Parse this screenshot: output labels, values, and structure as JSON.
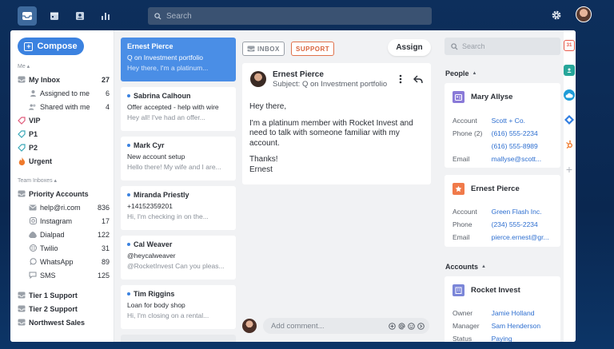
{
  "topbar": {
    "search_placeholder": "Search"
  },
  "sidebar": {
    "compose_label": "Compose",
    "me_label": "Me",
    "me_items": [
      {
        "label": "My Inbox",
        "count": "27"
      },
      {
        "label": "Assigned to me",
        "count": "6"
      },
      {
        "label": "Shared with me",
        "count": "4"
      }
    ],
    "tags": [
      {
        "label": "VIP",
        "color": "#e05a7a"
      },
      {
        "label": "P1",
        "color": "#3aa8b8"
      },
      {
        "label": "P2",
        "color": "#3aa8b8"
      },
      {
        "label": "Urgent",
        "color": "#ef7a2c"
      }
    ],
    "team_label": "Team Inboxes",
    "priority_label": "Priority Accounts",
    "team_items": [
      {
        "label": "help@ri.com",
        "count": "836"
      },
      {
        "label": "Instagram",
        "count": "17"
      },
      {
        "label": "Dialpad",
        "count": "122"
      },
      {
        "label": "Twilio",
        "count": "31"
      },
      {
        "label": "WhatsApp",
        "count": "89"
      },
      {
        "label": "SMS",
        "count": "125"
      }
    ],
    "bottom_items": [
      {
        "label": "Tier 1 Support"
      },
      {
        "label": "Tier 2 Support"
      },
      {
        "label": "Northwest Sales"
      }
    ]
  },
  "conversations": [
    {
      "name": "Ernest Pierce",
      "subject": "Q on Investment portfolio",
      "preview": "Hey there, I'm a platinum..."
    },
    {
      "name": "Sabrina Calhoun",
      "subject": "Offer accepted - help with wire",
      "preview": "Hey all! I've had an offer..."
    },
    {
      "name": "Mark Cyr",
      "subject": "New account setup",
      "preview": "Hello there! My wife and I are..."
    },
    {
      "name": "Miranda Priestly",
      "subject": "+14152359201",
      "preview": "Hi, I'm checking in on the..."
    },
    {
      "name": "Cal Weaver",
      "subject": "@heycalweaver",
      "preview": "@RocketInvest Can you pleas..."
    },
    {
      "name": "Tim Riggins",
      "subject": "Loan for body shop",
      "preview": "Hi, I'm closing on a rental..."
    }
  ],
  "message": {
    "tag_inbox": "INBOX",
    "tag_support": "SUPPORT",
    "assign_label": "Assign",
    "from": "Ernest Pierce",
    "subject": "Subject: Q on Investment portfolio",
    "body_greeting": "Hey there,",
    "body_text": "I'm a platinum member with Rocket Invest and need to talk with someone familiar with my account.",
    "body_thanks": "Thanks!",
    "body_sign": "Ernest",
    "comment_placeholder": "Add comment..."
  },
  "right": {
    "search_placeholder": "Search",
    "people_label": "People",
    "people": [
      {
        "name": "Mary Allyse",
        "icon_color": "#8a7ad8",
        "rows": [
          {
            "k": "Account",
            "v": "Scott + Co."
          },
          {
            "k": "Phone (2)",
            "v": "(616) 555-2234"
          },
          {
            "k": "",
            "v": "(616) 555-8989"
          },
          {
            "k": "Email",
            "v": "mallyse@scott..."
          }
        ]
      },
      {
        "name": "Ernest Pierce",
        "icon_color": "#f07a4a",
        "rows": [
          {
            "k": "Account",
            "v": "Green Flash Inc."
          },
          {
            "k": "Phone",
            "v": "(234) 555-2234"
          },
          {
            "k": "Email",
            "v": "pierce.ernest@gr..."
          }
        ]
      }
    ],
    "accounts_label": "Accounts",
    "account": {
      "name": "Rocket Invest",
      "icon_color": "#7b86d8",
      "rows": [
        {
          "k": "Owner",
          "v": "Jamie Holland"
        },
        {
          "k": "Manager",
          "v": "Sam Henderson"
        },
        {
          "k": "Status",
          "v": "Paying"
        }
      ]
    }
  },
  "strip": {
    "calendar_day": "31",
    "add_label": "+"
  },
  "colors": {
    "accent": "#3b82e0",
    "selected": "#4a8ee6",
    "support": "#d9633b",
    "link": "#2e6fd0"
  }
}
